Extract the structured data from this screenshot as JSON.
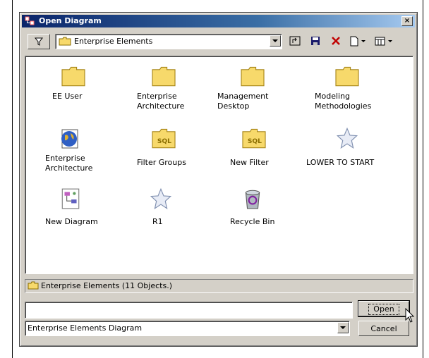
{
  "window": {
    "title": "Open Diagram",
    "close_glyph": "×"
  },
  "toolbar": {
    "filter_icon": "filter-icon",
    "location": "Enterprise Elements",
    "buttons": [
      "up-folder-icon",
      "save-icon",
      "delete-icon",
      "new-document-icon",
      "views-menu-icon"
    ]
  },
  "items": [
    {
      "label": "EE User",
      "icon": "folder-icon"
    },
    {
      "label": "Enterprise\nArchitecture",
      "icon": "folder-icon"
    },
    {
      "label": "Management\nDesktop",
      "icon": "folder-icon"
    },
    {
      "label": "Modeling\nMethodologies",
      "icon": "folder-icon"
    },
    {
      "label": "Enterprise\nArchitecture",
      "icon": "globe-icon"
    },
    {
      "label": "Filter Groups",
      "icon": "sql-folder-icon"
    },
    {
      "label": "New Filter",
      "icon": "sql-folder-icon"
    },
    {
      "label": "LOWER TO START",
      "icon": "star-icon"
    },
    {
      "label": "New Diagram",
      "icon": "diagram-icon"
    },
    {
      "label": "R1",
      "icon": "star-icon"
    },
    {
      "label": "Recycle Bin",
      "icon": "recycle-bin-icon"
    }
  ],
  "status": {
    "text": "Enterprise Elements (11 Objects.)"
  },
  "filename": {
    "value": ""
  },
  "filetype": {
    "selected": "Enterprise Elements Diagram"
  },
  "actions": {
    "open_label": "Open",
    "cancel_label": "Cancel"
  },
  "colors": {
    "folder": "#f7d96b",
    "titlebar": "#0a246a",
    "face": "#d4d0c8"
  }
}
